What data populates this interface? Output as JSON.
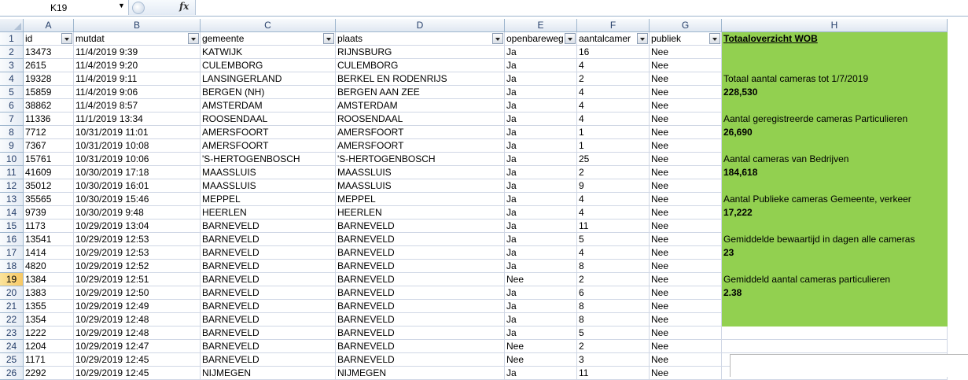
{
  "formula_bar": {
    "name_box": "K19",
    "fx_label": "fx",
    "formula": ""
  },
  "columns": [
    "A",
    "B",
    "C",
    "D",
    "E",
    "F",
    "G",
    "H"
  ],
  "header_row": [
    "id",
    "mutdat",
    "gemeente",
    "plaats",
    "openbareweg",
    "aantalcamer",
    "publiek"
  ],
  "rows": [
    [
      "13473",
      "11/4/2019 9:39",
      "KATWIJK",
      "RIJNSBURG",
      "Ja",
      "16",
      "Nee"
    ],
    [
      "2615",
      "11/4/2019 9:20",
      "CULEMBORG",
      "CULEMBORG",
      "Ja",
      "4",
      "Nee"
    ],
    [
      "19328",
      "11/4/2019 9:11",
      "LANSINGERLAND",
      "BERKEL EN RODENRIJS",
      "Ja",
      "2",
      "Nee"
    ],
    [
      "15859",
      "11/4/2019 9:06",
      "BERGEN (NH)",
      "BERGEN AAN ZEE",
      "Ja",
      "4",
      "Nee"
    ],
    [
      "38862",
      "11/4/2019 8:57",
      "AMSTERDAM",
      "AMSTERDAM",
      "Ja",
      "4",
      "Nee"
    ],
    [
      "11336",
      "11/1/2019 13:34",
      "ROOSENDAAL",
      "ROOSENDAAL",
      "Ja",
      "4",
      "Nee"
    ],
    [
      "7712",
      "10/31/2019 11:01",
      "AMERSFOORT",
      "AMERSFOORT",
      "Ja",
      "1",
      "Nee"
    ],
    [
      "7367",
      "10/31/2019 10:08",
      "AMERSFOORT",
      "AMERSFOORT",
      "Ja",
      "1",
      "Nee"
    ],
    [
      "15761",
      "10/31/2019 10:06",
      "'S-HERTOGENBOSCH",
      "'S-HERTOGENBOSCH",
      "Ja",
      "25",
      "Nee"
    ],
    [
      "41609",
      "10/30/2019 17:18",
      "MAASSLUIS",
      "MAASSLUIS",
      "Ja",
      "2",
      "Nee"
    ],
    [
      "35012",
      "10/30/2019 16:01",
      "MAASSLUIS",
      "MAASSLUIS",
      "Ja",
      "9",
      "Nee"
    ],
    [
      "35565",
      "10/30/2019 15:46",
      "MEPPEL",
      "MEPPEL",
      "Ja",
      "4",
      "Nee"
    ],
    [
      "9739",
      "10/30/2019 9:48",
      "HEERLEN",
      "HEERLEN",
      "Ja",
      "4",
      "Nee"
    ],
    [
      "1173",
      "10/29/2019 13:04",
      "BARNEVELD",
      "BARNEVELD",
      "Ja",
      "11",
      "Nee"
    ],
    [
      "13541",
      "10/29/2019 12:53",
      "BARNEVELD",
      "BARNEVELD",
      "Ja",
      "5",
      "Nee"
    ],
    [
      "1414",
      "10/29/2019 12:53",
      "BARNEVELD",
      "BARNEVELD",
      "Ja",
      "4",
      "Nee"
    ],
    [
      "4820",
      "10/29/2019 12:52",
      "BARNEVELD",
      "BARNEVELD",
      "Ja",
      "8",
      "Nee"
    ],
    [
      "1384",
      "10/29/2019 12:51",
      "BARNEVELD",
      "BARNEVELD",
      "Nee",
      "2",
      "Nee"
    ],
    [
      "1383",
      "10/29/2019 12:50",
      "BARNEVELD",
      "BARNEVELD",
      "Ja",
      "6",
      "Nee"
    ],
    [
      "1355",
      "10/29/2019 12:49",
      "BARNEVELD",
      "BARNEVELD",
      "Ja",
      "8",
      "Nee"
    ],
    [
      "1354",
      "10/29/2019 12:48",
      "BARNEVELD",
      "BARNEVELD",
      "Ja",
      "8",
      "Nee"
    ],
    [
      "1222",
      "10/29/2019 12:48",
      "BARNEVELD",
      "BARNEVELD",
      "Ja",
      "5",
      "Nee"
    ],
    [
      "1204",
      "10/29/2019 12:47",
      "BARNEVELD",
      "BARNEVELD",
      "Nee",
      "2",
      "Nee"
    ],
    [
      "1171",
      "10/29/2019 12:45",
      "BARNEVELD",
      "BARNEVELD",
      "Nee",
      "3",
      "Nee"
    ],
    [
      "2292",
      "10/29/2019 12:45",
      "NIJMEGEN",
      "NIJMEGEN",
      "Ja",
      "11",
      "Nee"
    ]
  ],
  "summary": {
    "title": "Totaaloverzicht WOB",
    "items": [
      {
        "label": "Totaal aantal cameras tot 1/7/2019",
        "value": "228,530"
      },
      {
        "label": "Aantal geregistreerde cameras Particulieren",
        "value": "26,690"
      },
      {
        "label": "Aantal cameras van Bedrijven",
        "value": "184,618"
      },
      {
        "label": "Aantal Publieke cameras Gemeente, verkeer",
        "value": "17,222"
      },
      {
        "label": "Gemiddelde bewaartijd in dagen alle cameras",
        "value": "23"
      },
      {
        "label": "Gemiddeld aantal cameras particulieren",
        "value": "2.38"
      }
    ]
  },
  "selected_row": 19,
  "colors": {
    "summary_fill": "#92d050",
    "grid_line": "#d0d7e5",
    "header_text": "#27406b"
  }
}
